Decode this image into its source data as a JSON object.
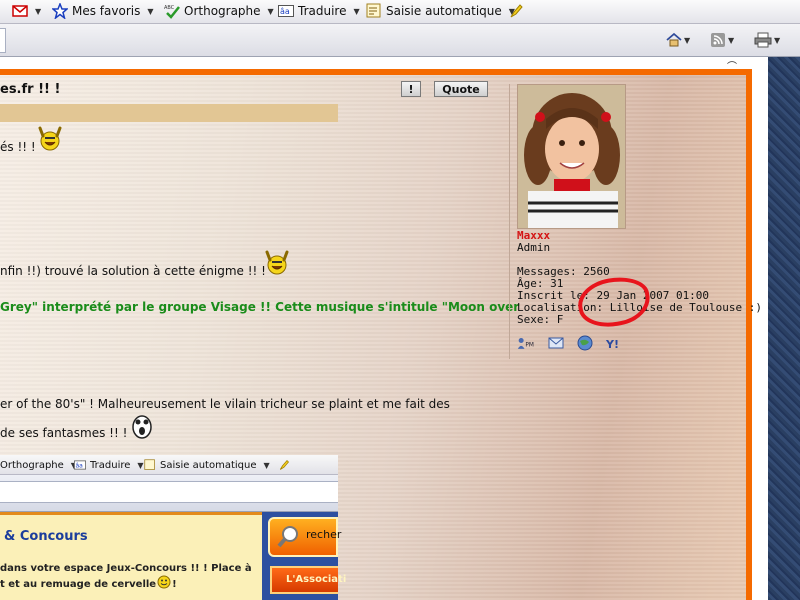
{
  "toolbar": {
    "favorites_label": "Mes favoris",
    "spelling_label": "Orthographe",
    "translate_label": "Traduire",
    "autofill_label": "Saisie automatique",
    "spelling_icon_text": "ABC",
    "translate_icon_text": "âa"
  },
  "post": {
    "title": "es.fr !! !",
    "exclaim_label": "!",
    "quote_label": "Quote",
    "lines": {
      "l1": "és !! !",
      "l2": "nfin !!) trouvé la solution à cette énigme !! !",
      "l3": "Grey\" interprété par le groupe Visage !! Cette musique s'intitule \"Moon over",
      "l4": "er of the 80's\" ! Malheureusement le vilain tricheur se plaint et me fait des",
      "l5": "de ses fantasmes !! !"
    }
  },
  "profile": {
    "name": "Maxxx",
    "role": "Admin",
    "messages": "Messages: 2560",
    "age": "Âge: 31",
    "joined": "Inscrit le: 29 Jan 2007 01:00",
    "location": "Localisation: Lilloise de Toulouse :)",
    "gender": "Sexe: F",
    "contact_icons": [
      "pm-icon",
      "email-icon",
      "website-icon",
      "yahoo-icon"
    ],
    "pm_text": "PM",
    "yahoo_text": "Y!"
  },
  "embedded": {
    "spelling_label": "Orthographe",
    "translate_label": "Traduire",
    "autofill_label": "Saisie automatique",
    "section_title": "& Concours",
    "text1": "dans   votre   espace   Jeux-Concours   !!   !   Place   à",
    "text2": "t et au remuage de cervelle !! !",
    "search_label": "recher",
    "assoc_label": "L'Associati"
  },
  "colors": {
    "accent_orange": "#f56a00",
    "name_red": "#d41515",
    "green_text": "#1a8c1a",
    "annotation_circle": "#e8141c"
  }
}
